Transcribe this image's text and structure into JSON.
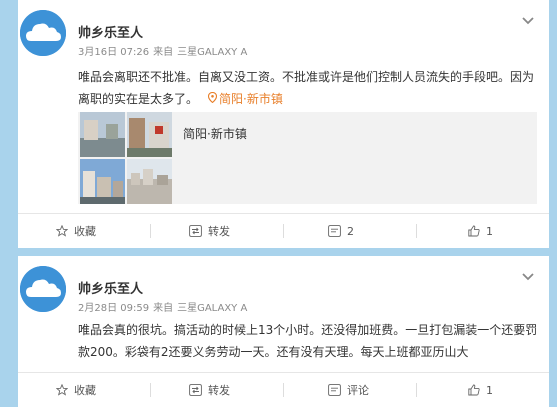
{
  "posts": [
    {
      "author": "帅乡乐至人",
      "date": "3月16日 07:26",
      "source_prefix": "来自",
      "device": "三星GALAXY A",
      "text": "唯品会离职还不批准。自离又没工资。不批准或许是他们控制人员流失的手段吧。因为离职的实在是太多了。",
      "location": "简阳·新市镇",
      "place_name": "简阳·新市镇",
      "actions": {
        "favorite": "收藏",
        "repost": "转发",
        "comment": "2",
        "like": "1"
      }
    },
    {
      "author": "帅乡乐至人",
      "date": "2月28日 09:59",
      "source_prefix": "来自",
      "device": "三星GALAXY A",
      "text": "唯品会真的很坑。搞活动的时候上13个小时。还没得加班费。一旦打包漏装一个还要罚款200。彩袋有2还要义务劳动一天。还有没有天理。每天上班都亚历山大",
      "actions": {
        "favorite": "收藏",
        "repost": "转发",
        "comment": "评论",
        "like": "1"
      }
    }
  ],
  "colors": {
    "page_bg": "#a9d3ec",
    "avatar_bg": "#3d92d7",
    "location": "#e87f2a",
    "meta": "#8a8a8a"
  },
  "icons": [
    "chevron-down-icon",
    "star-icon",
    "repost-icon",
    "comment-icon",
    "thumbs-up-icon",
    "location-pin-icon"
  ]
}
